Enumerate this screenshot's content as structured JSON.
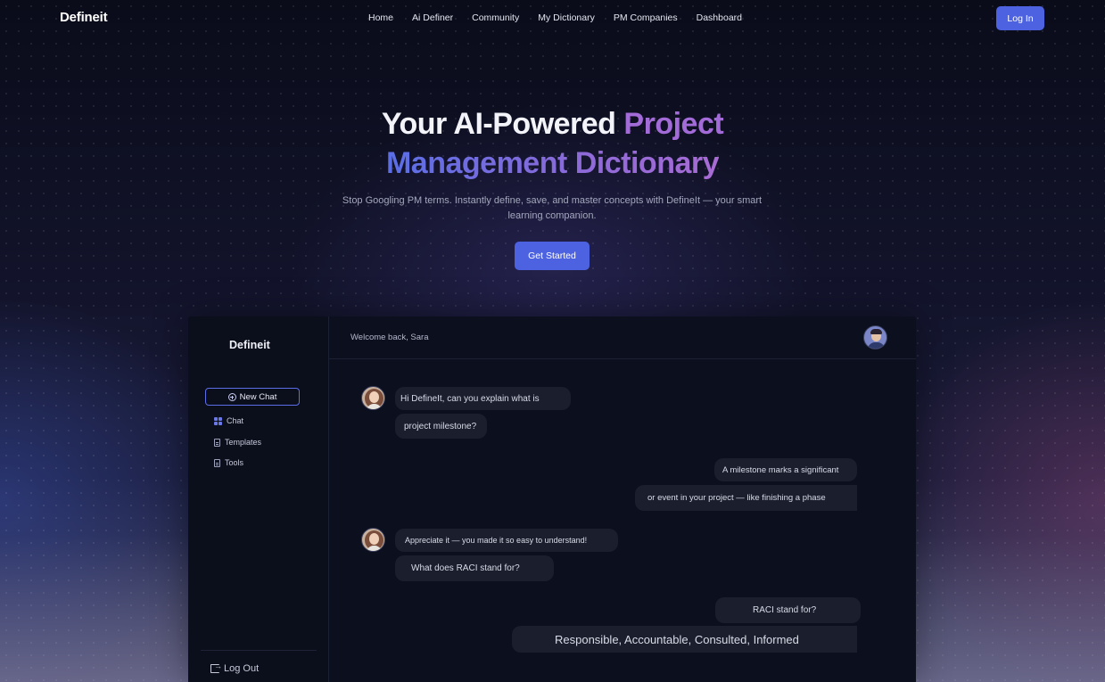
{
  "nav": {
    "logo": "Defineit",
    "links": [
      "Home",
      "Ai Definer",
      "Community",
      "My Dictionary",
      "PM Companies",
      "Dashboard"
    ],
    "login_label": "Log In"
  },
  "hero": {
    "title_part1": "Your AI-Powered ",
    "title_part2": "Project",
    "title_part3": "Management Dictionary",
    "subtitle": "Stop Googling PM terms. Instantly define, save, and master concepts with DefineIt — your smart learning companion.",
    "cta_label": "Get Started"
  },
  "app": {
    "logo": "Defineit",
    "new_chat_label": "New Chat",
    "sidebar_items": [
      {
        "label": "Chat",
        "icon": "grid-icon"
      },
      {
        "label": "Templates",
        "icon": "document-icon"
      },
      {
        "label": "Tools",
        "icon": "book-icon"
      }
    ],
    "logout_label": "Log Out",
    "welcome": "Welcome back, Sara",
    "messages": [
      {
        "from": "user",
        "text": "Hi DefineIt, can you explain what is"
      },
      {
        "from": "user",
        "text": "project milestone?"
      },
      {
        "from": "bot",
        "text": "A milestone marks a significant"
      },
      {
        "from": "bot",
        "text": "or event in your project — like finishing a phase"
      },
      {
        "from": "user",
        "text": "Appreciate it — you made it so easy to understand!"
      },
      {
        "from": "user",
        "text": "What does RACI stand for?"
      },
      {
        "from": "bot",
        "text": "RACI stand for?"
      },
      {
        "from": "bot",
        "text": "Responsible, Accountable, Consulted, Informed"
      }
    ]
  },
  "colors": {
    "accent": "#4d62e0",
    "title_purple": "#a36bd8",
    "background": "#0b0d19"
  }
}
